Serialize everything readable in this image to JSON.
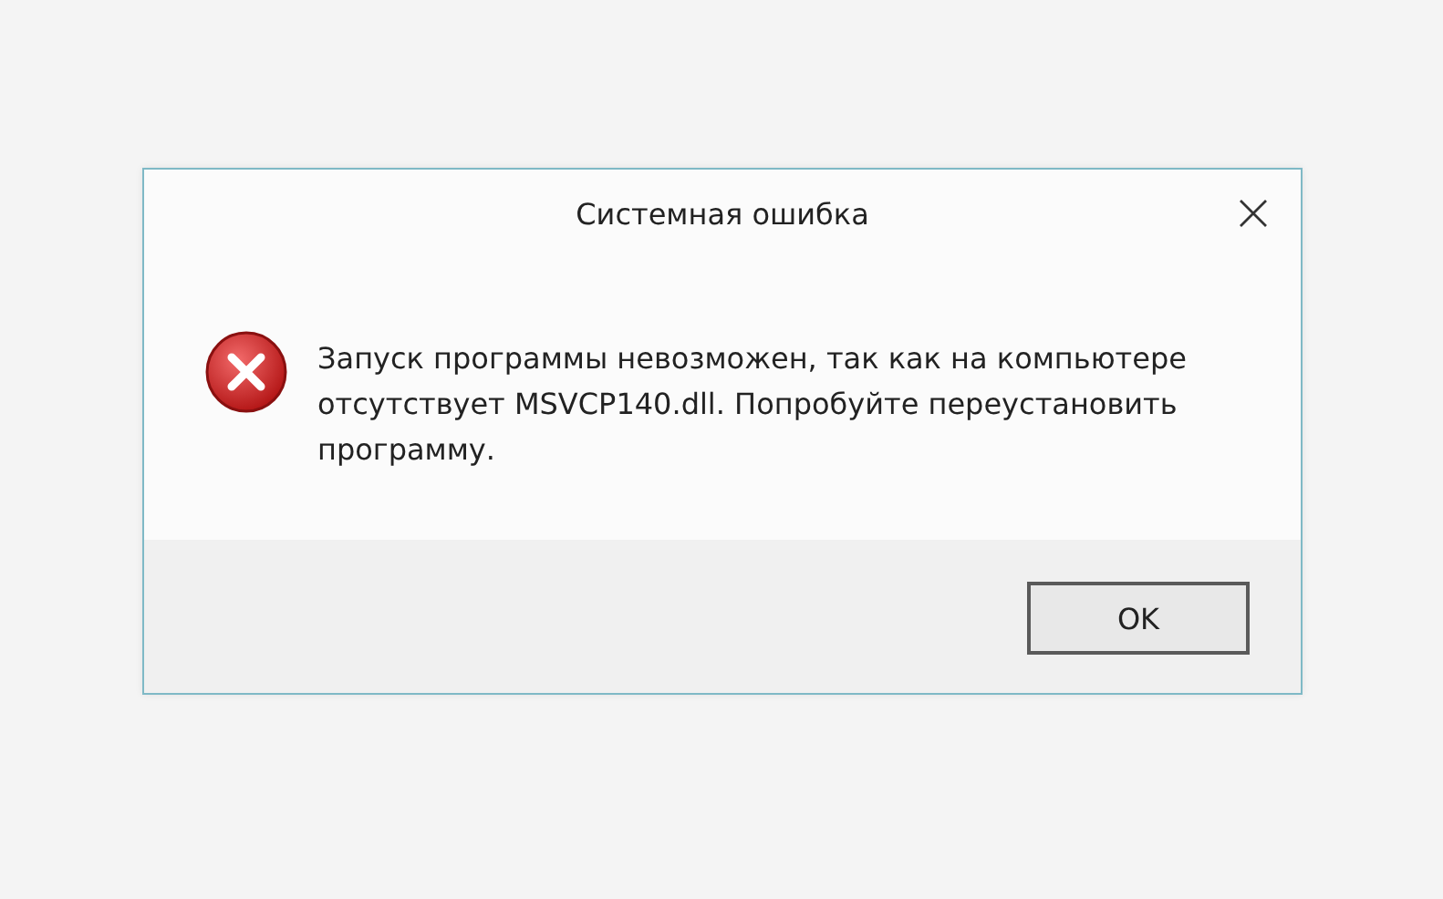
{
  "window": {
    "title": "Системная ошибка"
  },
  "message": "Запуск программы невозможен, так как на компьютере отсутствует MSVCP140.dll. Попробуйте переустановить программу.",
  "buttons": [
    {
      "label": "OK",
      "selected": true
    }
  ]
}
